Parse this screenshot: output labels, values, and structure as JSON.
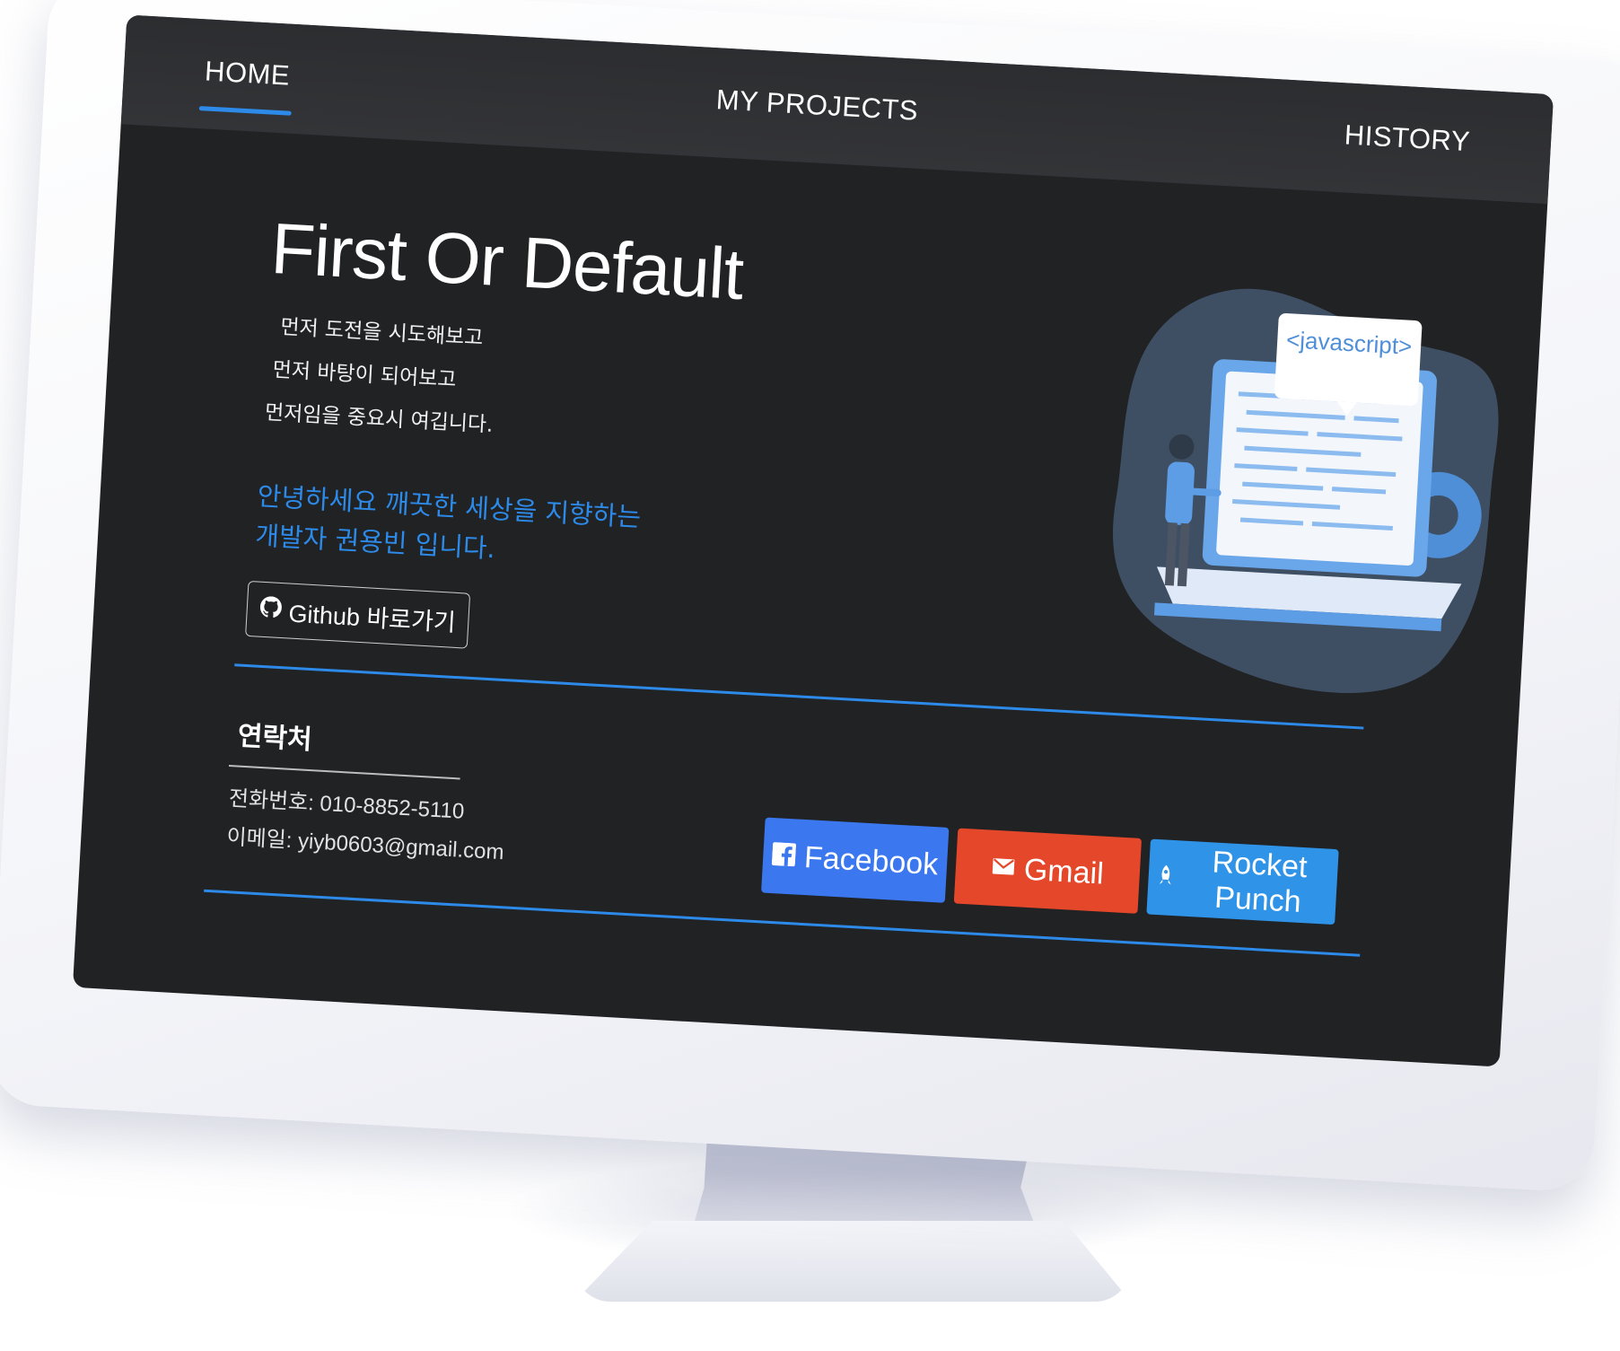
{
  "nav": {
    "home": "HOME",
    "projects": "MY PROJECTS",
    "history": "HISTORY"
  },
  "hero": {
    "title": "First Or Default",
    "taglines": [
      "먼저 도전을 시도해보고",
      "먼저 바탕이 되어보고",
      "먼저임을 중요시 여깁니다."
    ],
    "intro_line1": "안녕하세요 깨끗한 세상을 지향하는",
    "intro_line2": "개발자 권용빈 입니다.",
    "github_label": "Github 바로가기"
  },
  "illustration": {
    "bubble_text": "<javascript>"
  },
  "contact": {
    "title": "연락처",
    "phone": "전화번호: 010-8852-5110",
    "email": "이메일: yiyb0603@gmail.com"
  },
  "social": {
    "facebook": "Facebook",
    "gmail": "Gmail",
    "rocketpunch": "Rocket Punch"
  },
  "colors": {
    "accent": "#2d8ae8",
    "facebook": "#3b78f0",
    "gmail": "#e5472a",
    "rocketpunch": "#2f93e8",
    "screen_bg": "#202224"
  },
  "icons": {
    "github": "github-icon",
    "facebook": "facebook-icon",
    "gmail": "envelope-icon",
    "rocketpunch": "rocket-icon"
  }
}
